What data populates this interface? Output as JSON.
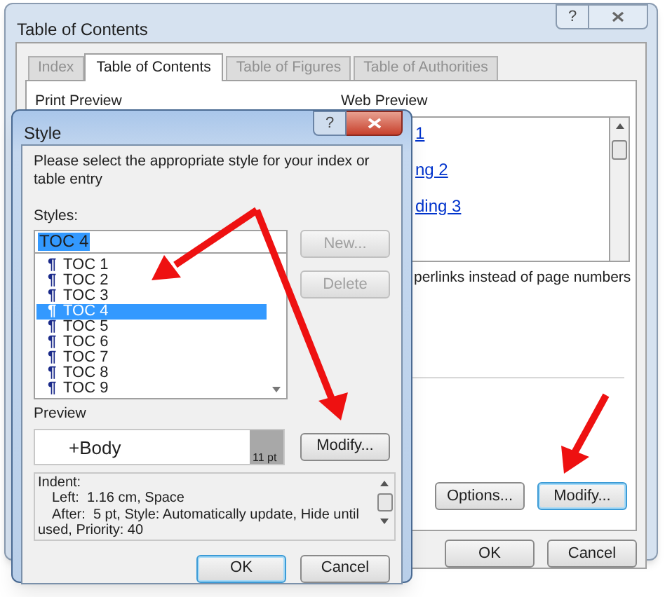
{
  "main_dialog": {
    "title": "Table of Contents",
    "help": "?",
    "tabs": [
      {
        "label": "Index",
        "selected": false
      },
      {
        "label": "Table of Contents",
        "selected": true
      },
      {
        "label": "Table of Figures",
        "selected": false
      },
      {
        "label": "Table of Authorities",
        "selected": false
      }
    ],
    "print_preview_label": "Print Preview",
    "web_preview_label": "Web Preview",
    "web_preview_lines": [
      "1",
      "ng 2",
      "ding 3"
    ],
    "hyperlinks_option": "perlinks instead of page numbers",
    "buttons": [
      {
        "label": "Options...",
        "focused": false
      },
      {
        "label": "Modify...",
        "focused": true
      }
    ],
    "footer_buttons": [
      {
        "label": "OK",
        "focused": false
      },
      {
        "label": "Cancel",
        "focused": false
      }
    ]
  },
  "style_dialog": {
    "title": "Style",
    "help": "?",
    "instructions": "Please select the appropriate style for your index or table entry",
    "styles_label": "Styles:",
    "style_name": "TOC 4",
    "side_buttons": [
      {
        "label": "New...",
        "disabled": true
      },
      {
        "label": "Delete",
        "disabled": true
      }
    ],
    "styles": [
      {
        "icon": "¶",
        "name": "TOC 1",
        "selected": false
      },
      {
        "icon": "¶",
        "name": "TOC 2",
        "selected": false
      },
      {
        "icon": "¶",
        "name": "TOC 3",
        "selected": false
      },
      {
        "icon": "¶",
        "name": "TOC 4",
        "selected": true
      },
      {
        "icon": "¶",
        "name": "TOC 5",
        "selected": false
      },
      {
        "icon": "¶",
        "name": "TOC 6",
        "selected": false
      },
      {
        "icon": "¶",
        "name": "TOC 7",
        "selected": false
      },
      {
        "icon": "¶",
        "name": "TOC 8",
        "selected": false
      },
      {
        "icon": "¶",
        "name": "TOC 9",
        "selected": false
      }
    ],
    "preview_label": "Preview",
    "preview_text": "+Body",
    "preview_size": "11 pt",
    "modify_button": {
      "label": "Modify...",
      "focused": false
    },
    "description": [
      "Indent:",
      "Left:  1.16 cm, Space",
      "After:  5 pt, Style: Automatically update, Hide until",
      "used, Priority: 40"
    ],
    "footer_buttons": [
      {
        "label": "OK",
        "focused": true
      },
      {
        "label": "Cancel",
        "focused": false
      }
    ]
  }
}
